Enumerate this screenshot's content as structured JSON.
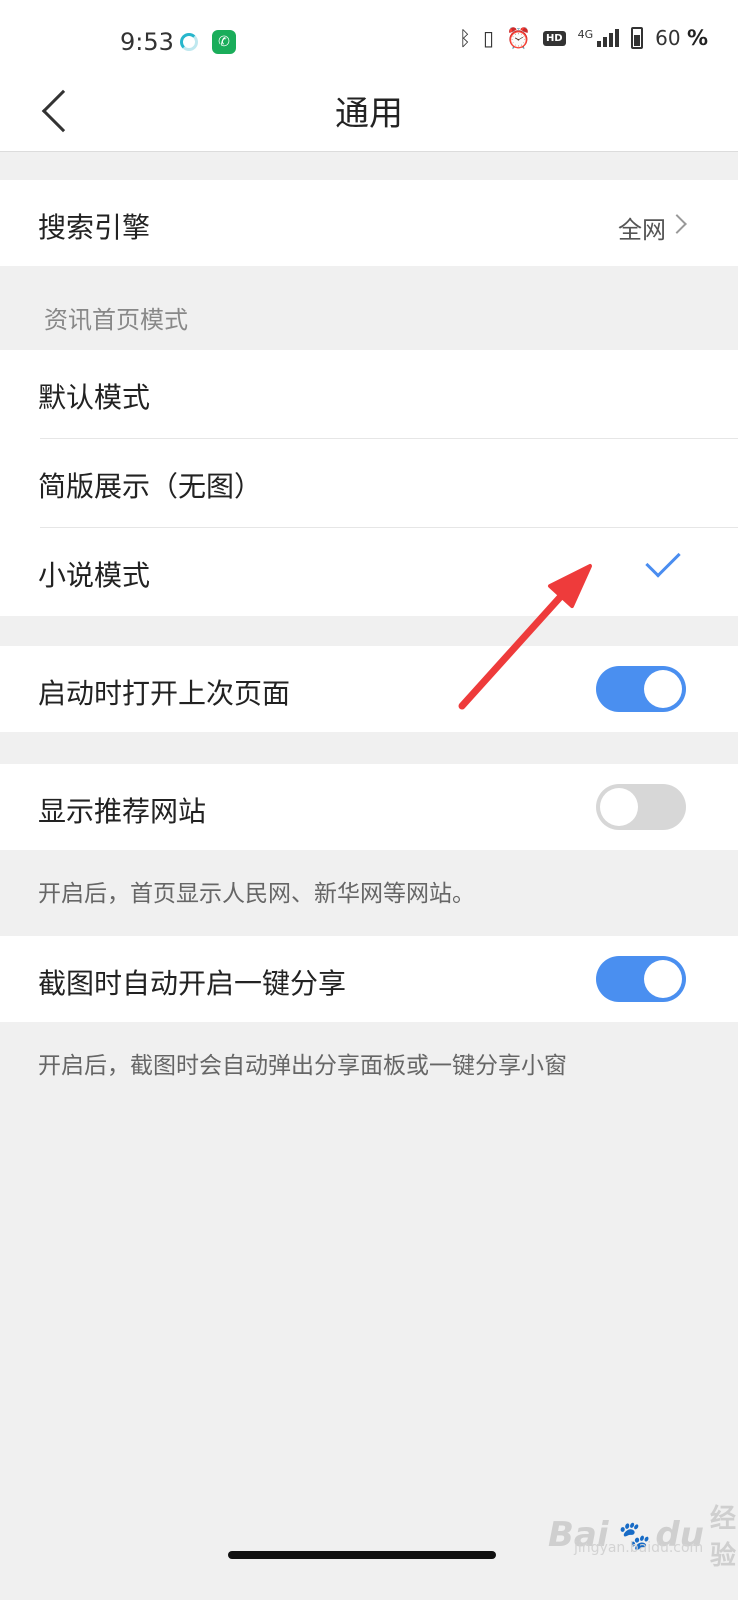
{
  "status_bar": {
    "time": "9:53",
    "battery_percent": "60",
    "battery_sign": "%",
    "network": "4G"
  },
  "header": {
    "title": "通用"
  },
  "search_engine": {
    "label": "搜索引擎",
    "value": "全网"
  },
  "news_mode": {
    "section_label": "资讯首页模式",
    "options": [
      {
        "label": "默认模式",
        "selected": false
      },
      {
        "label": "简版展示（无图）",
        "selected": false
      },
      {
        "label": "小说模式",
        "selected": true
      }
    ]
  },
  "settings": {
    "open_last_page": {
      "label": "启动时打开上次页面",
      "on": true
    },
    "show_recommended": {
      "label": "显示推荐网站",
      "on": false,
      "description": "开启后，首页显示人民网、新华网等网站。"
    },
    "screenshot_share": {
      "label": "截图时自动开启一键分享",
      "on": true,
      "description": "开启后，截图时会自动弹出分享面板或一键分享小窗"
    }
  },
  "watermark": {
    "brand": "Bai",
    "brand_du": "du",
    "cn": "经验",
    "url": "jingyan.baidu.com"
  },
  "colors": {
    "accent": "#4a8ff0",
    "annotation_arrow": "#ee3b3b",
    "background": "#f0f0f0"
  }
}
